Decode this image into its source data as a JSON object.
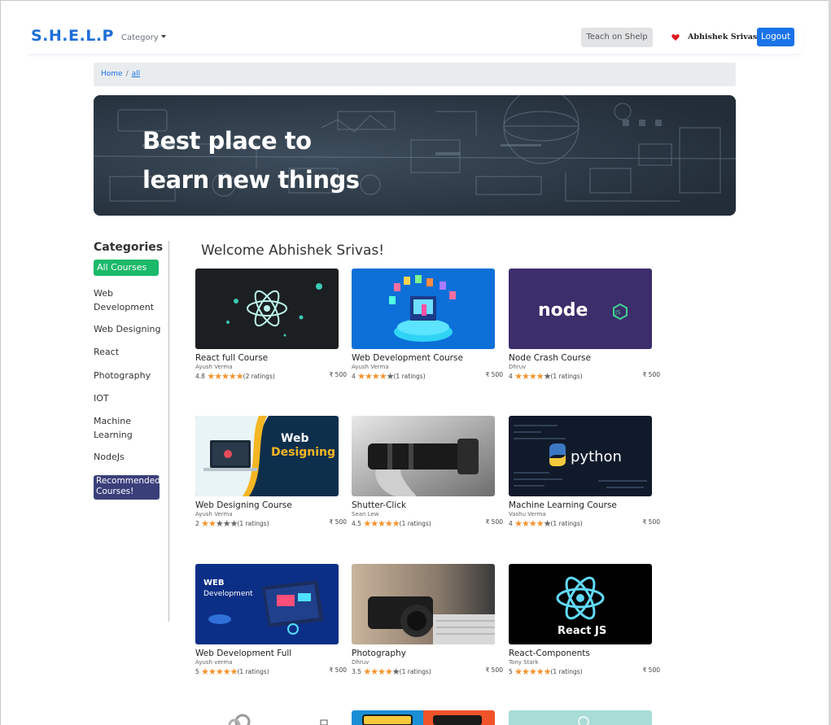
{
  "nav": {
    "brand": "S.H.E.L.P",
    "category_label": "Category",
    "teach_label": "Teach on Shelp",
    "user_name": "Abhishek Srivas",
    "logout_label": "Logout"
  },
  "breadcrumb": {
    "home": "Home",
    "separator": "/",
    "current": "all"
  },
  "hero": {
    "line1": "Best place to",
    "line2": "learn new things"
  },
  "sidebar": {
    "title": "Categories",
    "items": [
      {
        "label": "All Courses"
      },
      {
        "label": "Web Development"
      },
      {
        "label": "Web Designing"
      },
      {
        "label": "React"
      },
      {
        "label": "Photography"
      },
      {
        "label": "IOT"
      },
      {
        "label": "Machine Learning"
      },
      {
        "label": "NodeJs"
      },
      {
        "label": "Recommended Courses!"
      }
    ]
  },
  "welcome": "Welcome Abhishek Srivas!",
  "courses": [
    {
      "title": "React full Course",
      "author": "Ayush Verma",
      "rating": "4.8",
      "stars": 5,
      "count": "(2 ratings)",
      "price": "₹ 500",
      "thumb_text": ""
    },
    {
      "title": "Web Development Course",
      "author": "Ayush Verma",
      "rating": "4",
      "stars": 4,
      "count": "(1 ratings)",
      "price": "₹ 500",
      "thumb_text": ""
    },
    {
      "title": "Node Crash Course",
      "author": "Dhruv",
      "rating": "4",
      "stars": 4,
      "count": "(1 ratings)",
      "price": "₹ 500",
      "thumb_text": "node"
    },
    {
      "title": "Web Designing Course",
      "author": "Ayush Verma",
      "rating": "2",
      "stars": 2,
      "count": "(1 ratings)",
      "price": "₹ 500",
      "thumb_text": "Web Designing"
    },
    {
      "title": "Shutter-Click",
      "author": "Sean Lew",
      "rating": "4.5",
      "stars": 5,
      "count": "(1 ratings)",
      "price": "₹ 500",
      "thumb_text": ""
    },
    {
      "title": "Machine Learning Course",
      "author": "Vashu Verma",
      "rating": "4",
      "stars": 4,
      "count": "(1 ratings)",
      "price": "₹ 500",
      "thumb_text": "python"
    },
    {
      "title": "Web Development Full",
      "author": "Ayush verma",
      "rating": "5",
      "stars": 5,
      "count": "(1 ratings)",
      "price": "₹ 500",
      "thumb_text": "WEB Development"
    },
    {
      "title": "Photography",
      "author": "Dhruv",
      "rating": "3.5",
      "stars": 4,
      "count": "(1 ratings)",
      "price": "₹ 500",
      "thumb_text": ""
    },
    {
      "title": "React-Components",
      "author": "Tony Stark",
      "rating": "5",
      "stars": 5,
      "count": "(1 ratings)",
      "price": "₹ 500",
      "thumb_text": "React JS"
    }
  ],
  "colors": {
    "brand": "#1e6fd9",
    "accent_green": "#1bb96a",
    "recommended_bg": "#3a3f7a",
    "star": "#f3922d"
  }
}
